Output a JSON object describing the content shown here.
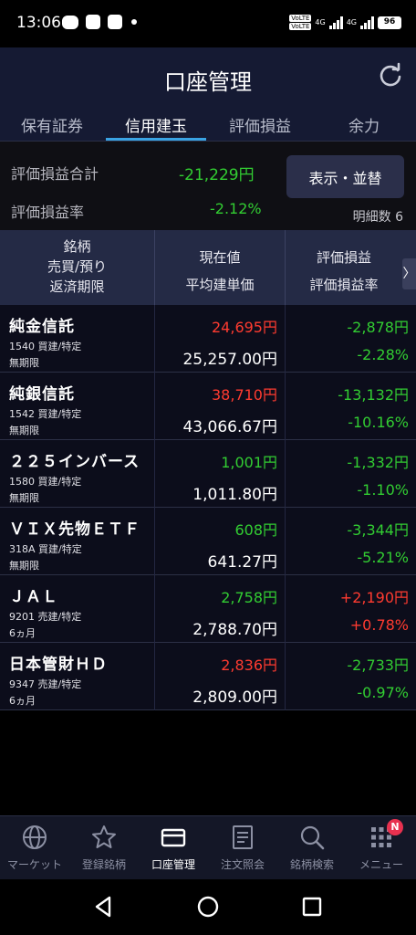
{
  "status_bar": {
    "time": "13:06",
    "volte1": "VoLTE",
    "volte2": "VoLTE",
    "net1": "4G",
    "net2": "4G",
    "battery": "96"
  },
  "header": {
    "title": "口座管理",
    "tabs": [
      "保有証券",
      "信用建玉",
      "評価損益",
      "余力"
    ],
    "active_tab": 1
  },
  "summary": {
    "total_pl_label": "評価損益合計",
    "total_pl_value": "-21,229円",
    "pl_rate_label": "評価損益率",
    "pl_rate_value": "-2.12%",
    "display_button": "表示・並替",
    "detail_count": "明細数 6"
  },
  "table_header": {
    "col1": [
      "銘柄",
      "売買/預り",
      "返済期限"
    ],
    "col2": [
      "現在値",
      "平均建単価"
    ],
    "col3": [
      "評価損益",
      "評価損益率"
    ],
    "arrow": "〉"
  },
  "rows": [
    {
      "name": "純金信託",
      "sub1": "1540 買建/特定",
      "sub2": "無期限",
      "price": "24,695円",
      "price_color": "#ff3b30",
      "avg": "25,257.00円",
      "pl": "-2,878円",
      "pl_color": "#32cd32",
      "rate": "-2.28%",
      "rate_color": "#32cd32"
    },
    {
      "name": "純銀信託",
      "sub1": "1542 買建/特定",
      "sub2": "無期限",
      "price": "38,710円",
      "price_color": "#ff3b30",
      "avg": "43,066.67円",
      "pl": "-13,132円",
      "pl_color": "#32cd32",
      "rate": "-10.16%",
      "rate_color": "#32cd32"
    },
    {
      "name": "２２５インバース",
      "sub1": "1580 買建/特定",
      "sub2": "無期限",
      "price": "1,001円",
      "price_color": "#32cd32",
      "avg": "1,011.80円",
      "pl": "-1,332円",
      "pl_color": "#32cd32",
      "rate": "-1.10%",
      "rate_color": "#32cd32"
    },
    {
      "name": "ＶＩＸ先物ＥＴＦ",
      "sub1": "318A 買建/特定",
      "sub2": "無期限",
      "price": "608円",
      "price_color": "#32cd32",
      "avg": "641.27円",
      "pl": "-3,344円",
      "pl_color": "#32cd32",
      "rate": "-5.21%",
      "rate_color": "#32cd32"
    },
    {
      "name": "ＪＡＬ",
      "sub1": "9201 売建/特定",
      "sub2": "6ヵ月",
      "price": "2,758円",
      "price_color": "#32cd32",
      "avg": "2,788.70円",
      "pl": "+2,190円",
      "pl_color": "#ff3b30",
      "rate": "+0.78%",
      "rate_color": "#ff3b30"
    },
    {
      "name": "日本管財ＨＤ",
      "sub1": "9347 売建/特定",
      "sub2": "6ヵ月",
      "price": "2,836円",
      "price_color": "#ff3b30",
      "avg": "2,809.00円",
      "pl": "-2,733円",
      "pl_color": "#32cd32",
      "rate": "-0.97%",
      "rate_color": "#32cd32"
    }
  ],
  "bottom_nav": {
    "items": [
      {
        "label": "マーケット",
        "icon": "globe-icon"
      },
      {
        "label": "登録銘柄",
        "icon": "star-icon"
      },
      {
        "label": "口座管理",
        "icon": "card-icon"
      },
      {
        "label": "注文照会",
        "icon": "document-icon"
      },
      {
        "label": "銘柄検索",
        "icon": "search-icon"
      },
      {
        "label": "メニュー",
        "icon": "grid-icon"
      }
    ],
    "active_index": 2,
    "badge": "N"
  },
  "colors": {
    "header_bg": "#151a33",
    "gain": "#ff3b30",
    "loss": "#32cd32",
    "accent": "#3aa3e3"
  }
}
